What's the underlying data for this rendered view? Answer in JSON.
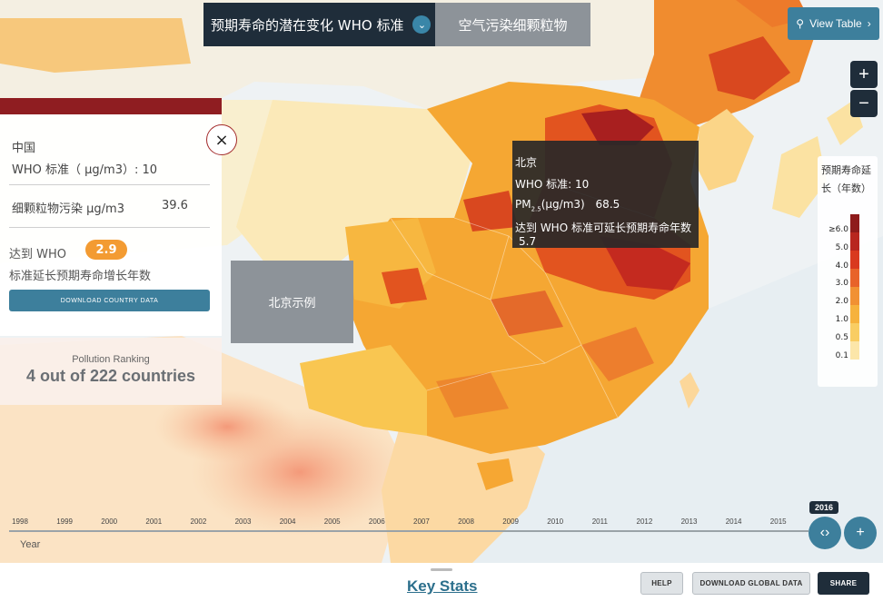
{
  "header": {
    "metric_selected": "预期寿命的潜在变化 WHO 标准",
    "metric_alternate": "空气污染细颗粒物",
    "view_table_label": "View Table"
  },
  "zoom": {
    "in_label": "+",
    "out_label": "−"
  },
  "legend": {
    "title": "预期寿命延长（年数）",
    "labels": [
      "≥6.0",
      "5.0",
      "4.0",
      "3.0",
      "2.0",
      "1.0",
      "0.5",
      "0.1"
    ],
    "colors": [
      "#8e1b1b",
      "#b8261f",
      "#d9391f",
      "#e8632a",
      "#f19133",
      "#f6b23d",
      "#f9cd63",
      "#fce6a9"
    ]
  },
  "country_panel": {
    "country": "中国",
    "who_standard": "WHO 标准（ µg/m3）: 10",
    "pm_label": "细颗粒物污染 µg/m3",
    "pm_value": "39.6",
    "gain_label_1": "达到 WHO",
    "gain_value": "2.9",
    "gain_label_2": "标准延长预期寿命增长年数",
    "download_label": "DOWNLOAD COUNTRY DATA",
    "ranking_title": "Pollution Ranking",
    "ranking_value": "4 out of 222 countries",
    "close_label": "×"
  },
  "tooltip": {
    "city": "北京",
    "who_line": "WHO 标准: 10",
    "pm_prefix": "PM",
    "pm_sub": "2.5",
    "pm_suffix": "(µg/m3)",
    "pm_value": "68.5",
    "gain_line": "达到 WHO 标准可延长预期寿命年数",
    "gain_value": "5.7"
  },
  "example_label": "北京示例",
  "timeline": {
    "years": [
      "1998",
      "1999",
      "2000",
      "2001",
      "2002",
      "2003",
      "2004",
      "2005",
      "2006",
      "2007",
      "2008",
      "2009",
      "2010",
      "2011",
      "2012",
      "2013",
      "2014",
      "2015"
    ],
    "selected_year": "2016",
    "axis_label": "Year",
    "play_label": "‹›",
    "add_label": "+"
  },
  "footer": {
    "key_stats": "Key Stats",
    "help": "HELP",
    "download_global": "DOWNLOAD GLOBAL DATA",
    "share": "SHARE"
  }
}
